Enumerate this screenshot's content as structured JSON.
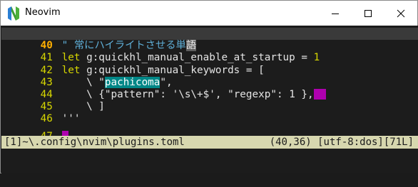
{
  "window": {
    "title": "Neovim",
    "controls": {
      "minimize": "minimize-icon",
      "maximize": "maximize-icon",
      "close": "close-icon"
    }
  },
  "editor": {
    "lines": [
      {
        "num": "40",
        "current": true,
        "kind": "comment",
        "text": "\" 常にハイライトさせる単",
        "tail": "語"
      },
      {
        "num": "41",
        "current": false,
        "kind": "let",
        "kw": "let",
        "rest": " g:quickhl_manual_enable_at_startup = ",
        "value": "1"
      },
      {
        "num": "42",
        "current": false,
        "kind": "let",
        "kw": "let",
        "rest": " g:quickhl_manual_keywords = ["
      },
      {
        "num": "43",
        "current": false,
        "kind": "item1",
        "prefix": "    \\ \"",
        "hl": "pachicoma",
        "suffix": "\","
      },
      {
        "num": "44",
        "current": false,
        "kind": "item2",
        "prefix": "    \\ {",
        "k1": "\"pattern\"",
        "m1": ": ",
        "v1": "'\\s\\+$'",
        "m2": ", ",
        "k2": "\"regexp\"",
        "m3": ": ",
        "v2": "1",
        "m4": " },"
      },
      {
        "num": "45",
        "current": false,
        "kind": "plain",
        "text": "    \\ ]"
      },
      {
        "num": "46",
        "current": false,
        "kind": "plain",
        "text": "'''"
      },
      {
        "num": "47",
        "current": false,
        "kind": "empty",
        "text": ""
      }
    ]
  },
  "statusline": {
    "left": "[1]~\\.config\\nvim\\plugins.toml",
    "right": "(40,36) [utf-8:dos][71L]"
  },
  "colors": {
    "background": "#1c1c1c",
    "linenr": "#d7d700",
    "statusline": "#d7d7af",
    "highlight_magenta": "#af00af",
    "highlight_teal": "#008787"
  }
}
